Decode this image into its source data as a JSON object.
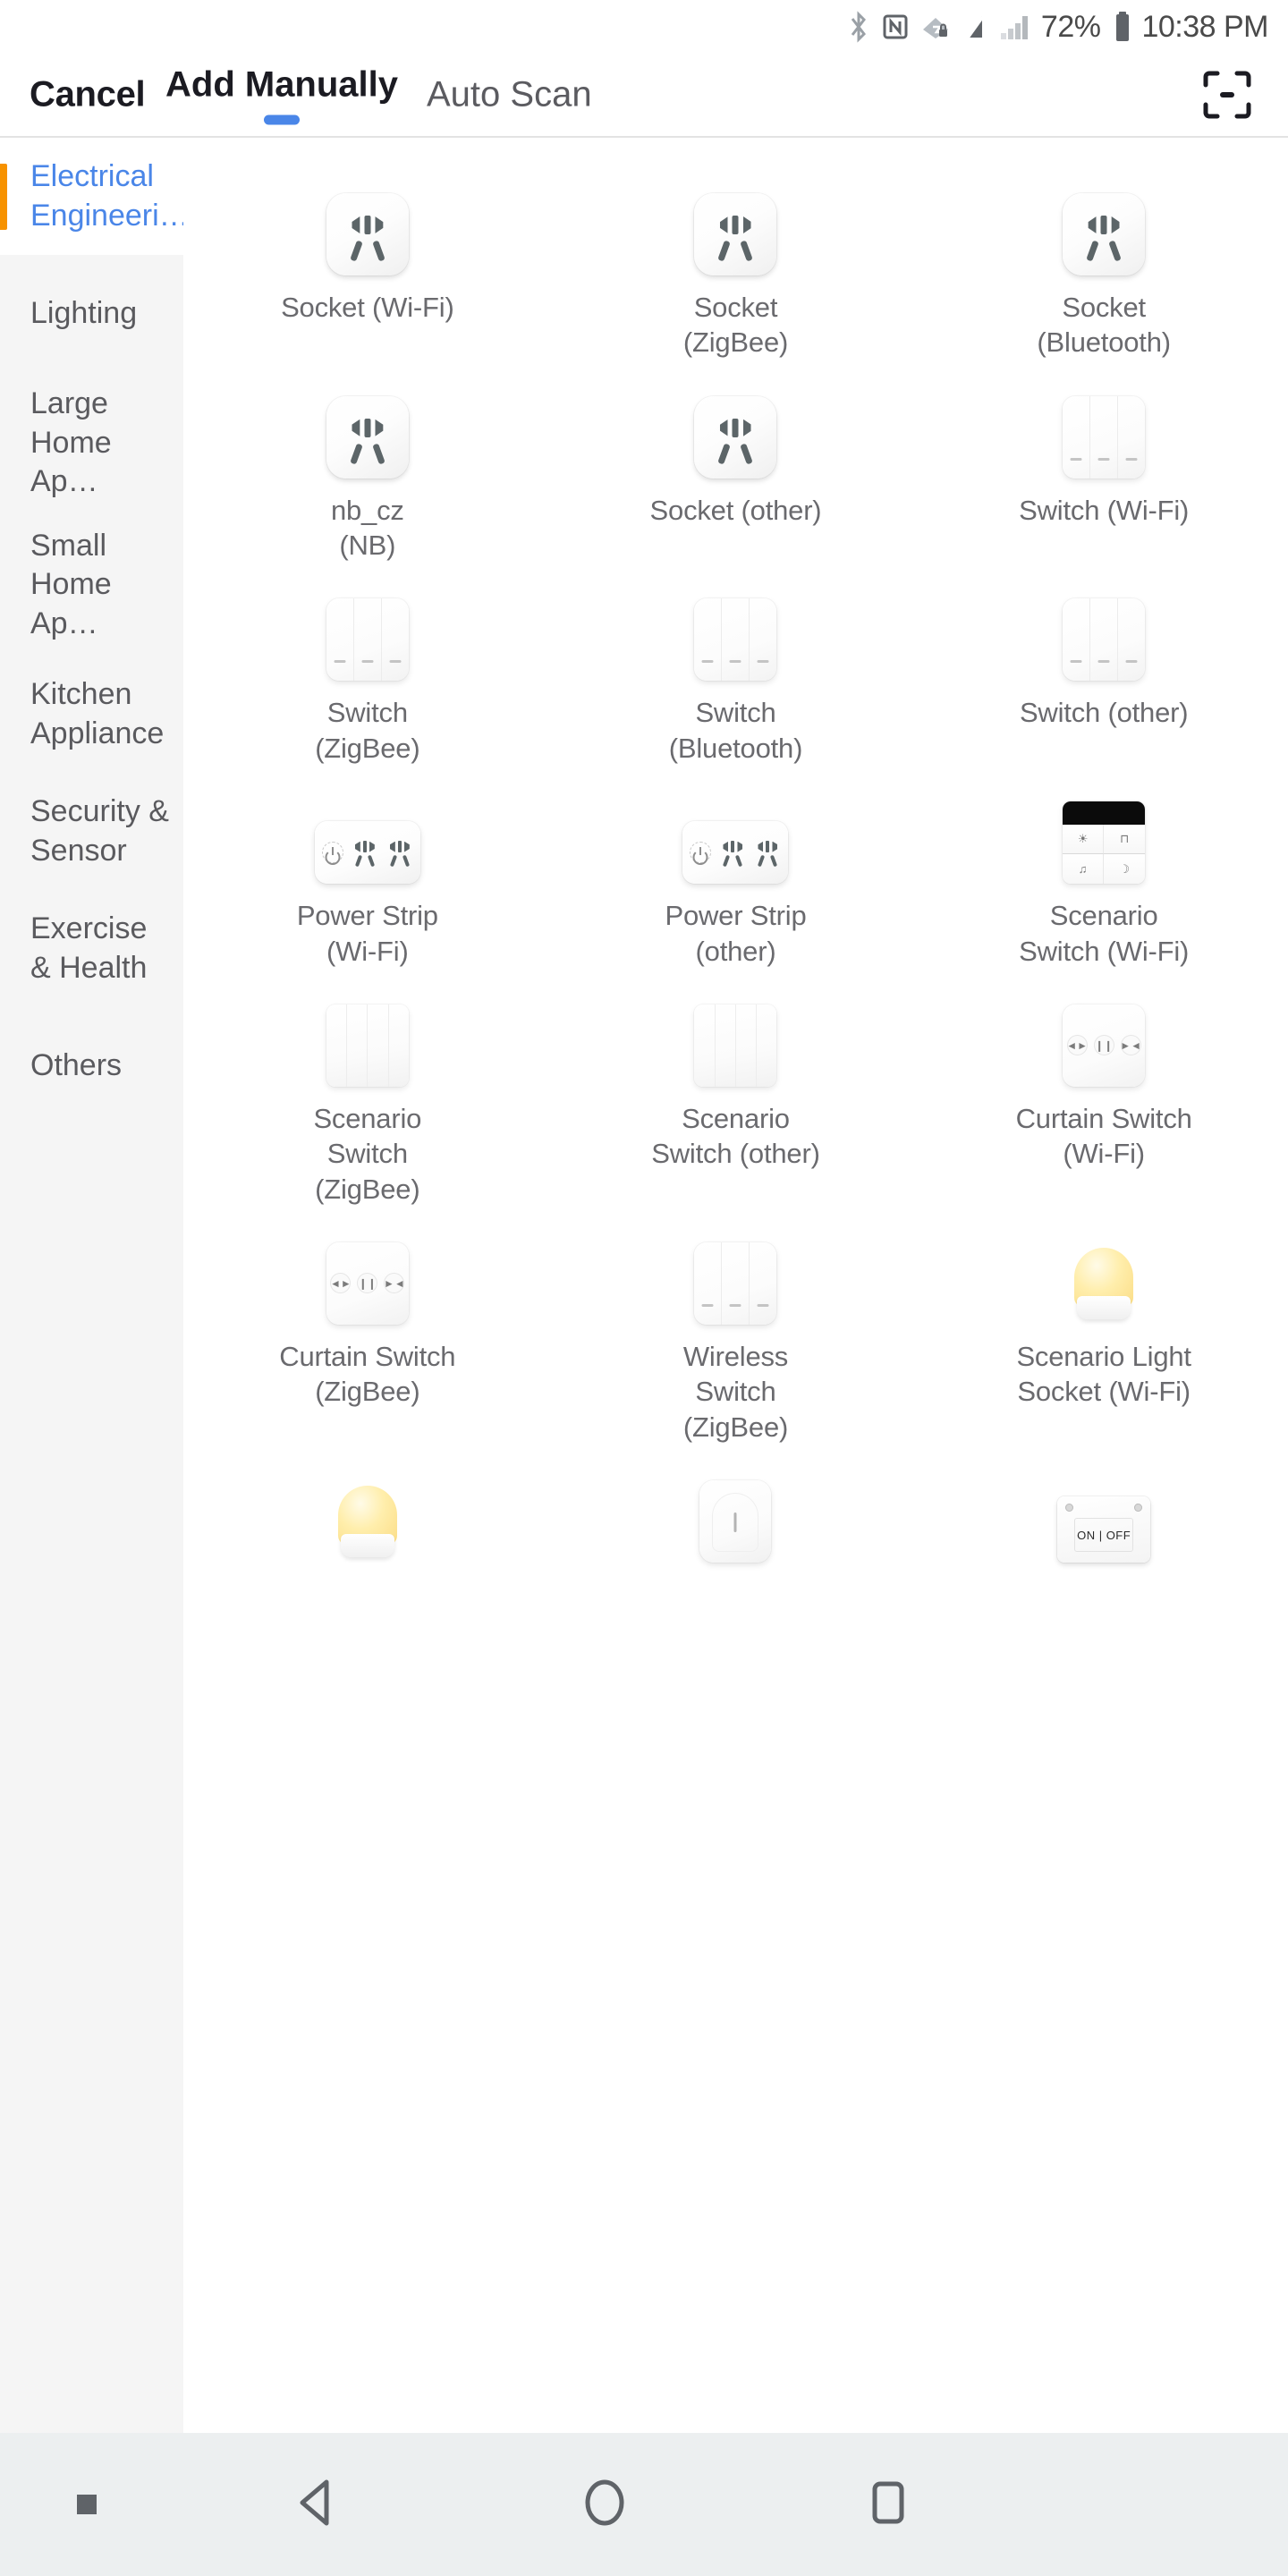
{
  "status_bar": {
    "icons": [
      "bluetooth-icon",
      "nfc-icon",
      "wifi-secure-icon",
      "do-not-disturb-icon",
      "signal-icon"
    ],
    "battery_percent": "72%",
    "battery_icon": "battery-icon",
    "clock": "10:38 PM"
  },
  "navbar": {
    "cancel_label": "Cancel",
    "tab_manual_label": "Add Manually",
    "tab_auto_label": "Auto Scan",
    "scan_icon": "qr-scan-icon"
  },
  "sidebar": {
    "items": [
      {
        "label": "Electrical Engineeri…",
        "active": true
      },
      {
        "label": "Lighting",
        "active": false
      },
      {
        "label": "Large Home Ap…",
        "active": false
      },
      {
        "label": "Small Home Ap…",
        "active": false
      },
      {
        "label": "Kitchen Appliance",
        "active": false
      },
      {
        "label": "Security & Sensor",
        "active": false
      },
      {
        "label": "Exercise & Health",
        "active": false
      },
      {
        "label": "Others",
        "active": false
      }
    ]
  },
  "devices": [
    {
      "label": "Socket (Wi-Fi)",
      "icon": "socket-icon"
    },
    {
      "label": "Socket\n(ZigBee)",
      "icon": "socket-icon"
    },
    {
      "label": "Socket\n(Bluetooth)",
      "icon": "socket-icon"
    },
    {
      "label": "nb_cz\n(NB)",
      "icon": "socket-icon"
    },
    {
      "label": "Socket (other)",
      "icon": "socket-icon"
    },
    {
      "label": "Switch (Wi-Fi)",
      "icon": "switch-icon"
    },
    {
      "label": "Switch\n(ZigBee)",
      "icon": "switch-icon"
    },
    {
      "label": "Switch\n(Bluetooth)",
      "icon": "switch-icon"
    },
    {
      "label": "Switch (other)",
      "icon": "switch-icon"
    },
    {
      "label": "Power Strip\n(Wi-Fi)",
      "icon": "power-strip-icon"
    },
    {
      "label": "Power Strip\n(other)",
      "icon": "power-strip-icon"
    },
    {
      "label": "Scenario\nSwitch (Wi-Fi)",
      "icon": "scenario-switch-wifi-icon"
    },
    {
      "label": "Scenario\nSwitch\n(ZigBee)",
      "icon": "scenario-switch-icon"
    },
    {
      "label": "Scenario\nSwitch (other)",
      "icon": "scenario-switch-icon"
    },
    {
      "label": "Curtain Switch\n(Wi-Fi)",
      "icon": "curtain-switch-icon"
    },
    {
      "label": "Curtain Switch\n(ZigBee)",
      "icon": "curtain-switch-icon"
    },
    {
      "label": "Wireless\nSwitch\n(ZigBee)",
      "icon": "switch-icon"
    },
    {
      "label": "Scenario Light\nSocket (Wi-Fi)",
      "icon": "night-light-icon"
    },
    {
      "label": "",
      "icon": "night-light-icon"
    },
    {
      "label": "",
      "icon": "wireless-button-icon"
    },
    {
      "label": "",
      "icon": "on-off-module-icon"
    }
  ],
  "scenario_switch_keys": [
    "Light",
    "Curtain",
    "Morning",
    "Relax"
  ],
  "on_off_module_text": "ON | OFF",
  "android_nav": {
    "menu_icon": "menu-square-icon",
    "back_icon": "back-triangle-icon",
    "home_icon": "home-circle-icon",
    "recents_icon": "recents-square-icon"
  },
  "colors": {
    "accent_blue": "#4a86e8",
    "active_marker_orange": "#f79200",
    "sidebar_bg": "#f5f5f5",
    "nav_bg": "#eceff0",
    "text_primary": "#1b1b22",
    "text_secondary": "#6a6a6e"
  }
}
